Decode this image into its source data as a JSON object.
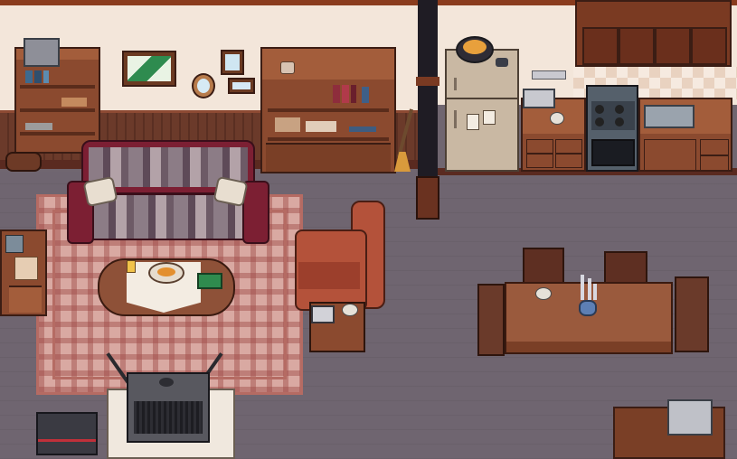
{
  "scene": {
    "room": "living-room-kitchen",
    "colors": {
      "wall": "#f3e6da",
      "floor": "#6f6570",
      "wood": "#8b4a2f",
      "rug": "#d9a9a2",
      "sofa_frame": "#7c1f33",
      "armchair": "#b4523a"
    }
  },
  "objects": {
    "icons": [
      "picture-frame-icon",
      "mirror-icon",
      "fruit-bowl-icon",
      "cup-icon",
      "book-icon",
      "antenna-icon",
      "phone-icon",
      "flower-vase-icon"
    ]
  }
}
